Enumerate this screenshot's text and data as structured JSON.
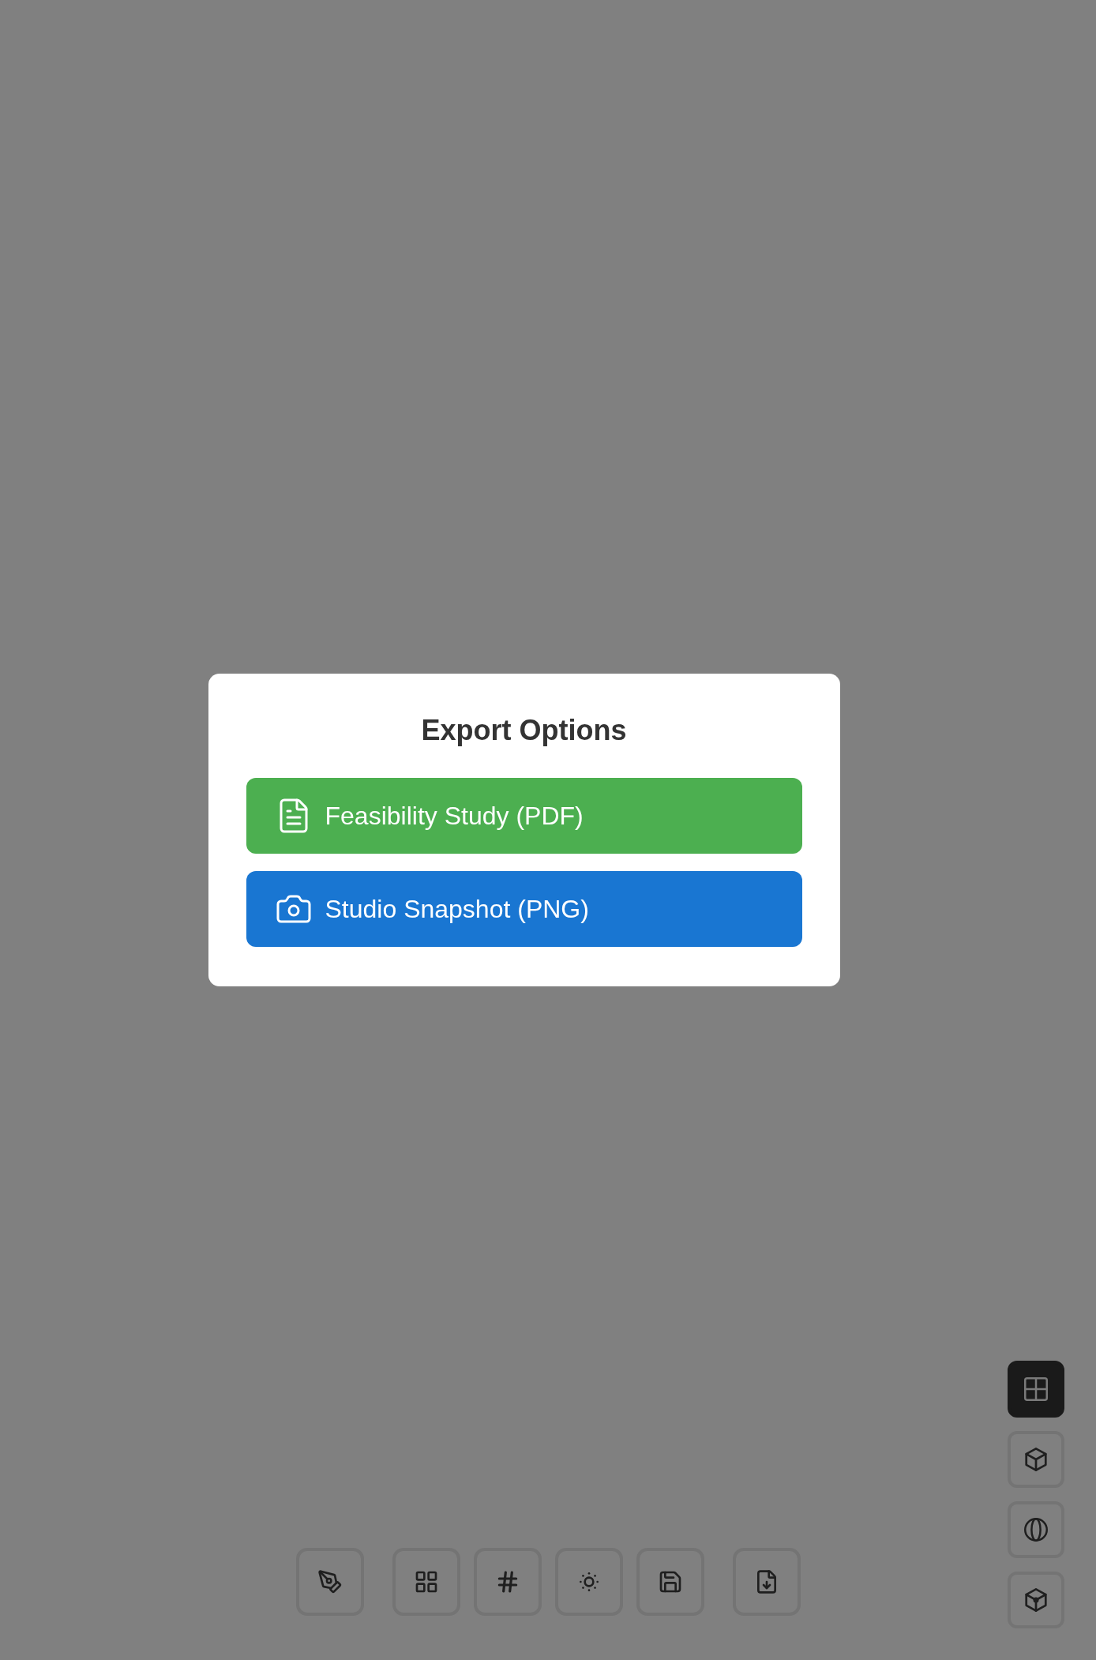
{
  "dialog": {
    "title": "Export Options",
    "options": [
      {
        "kind": "pdf",
        "label": "Feasibility Study (PDF)"
      },
      {
        "kind": "png",
        "label": "Studio Snapshot (PNG)"
      }
    ]
  },
  "view_buttons": [
    {
      "kind": "grid",
      "selected": true
    },
    {
      "kind": "cube",
      "selected": false
    },
    {
      "kind": "sphere",
      "selected": false
    },
    {
      "kind": "cube-dot",
      "selected": false
    }
  ]
}
